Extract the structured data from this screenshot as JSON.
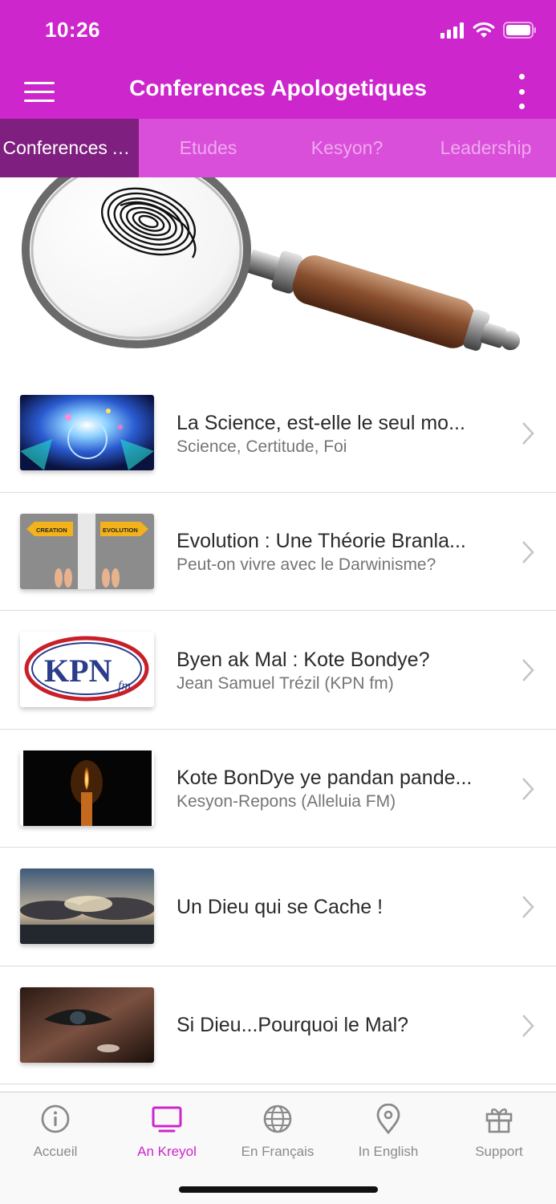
{
  "status_bar": {
    "time": "10:26"
  },
  "app_bar": {
    "title": "Conferences Apologetiques"
  },
  "tabs": [
    {
      "label": "Conferences Apologetiques",
      "active": true
    },
    {
      "label": "Etudes",
      "active": false
    },
    {
      "label": "Kesyon?",
      "active": false
    },
    {
      "label": "Leadership",
      "active": false
    }
  ],
  "items": [
    {
      "title": "La Science, est-elle le seul mo...",
      "subtitle": "Science, Certitude, Foi",
      "thumb": "science-brain-thumbnail"
    },
    {
      "title": "Evolution : Une Théorie Branla...",
      "subtitle": "Peut-on vivre avec le Darwinisme?",
      "thumb": "creation-evolution-thumbnail",
      "thumb_labels": [
        "CREATION",
        "EVOLUTION"
      ]
    },
    {
      "title": "Byen ak Mal : Kote Bondye?",
      "subtitle": "Jean Samuel Trézil (KPN fm)",
      "thumb": "kpn-fm-logo-thumbnail",
      "thumb_labels": [
        "KPN",
        "fm"
      ]
    },
    {
      "title": "Kote BonDye ye pandan pande...",
      "subtitle": "Kesyon-Repons (Alleluia FM)",
      "thumb": "candle-thumbnail"
    },
    {
      "title": "Un Dieu qui se Cache !",
      "subtitle": "",
      "thumb": "clouds-sunset-thumbnail"
    },
    {
      "title": "Si Dieu...Pourquoi le Mal?",
      "subtitle": "",
      "thumb": "tear-eye-thumbnail"
    }
  ],
  "bottom_tabs": [
    {
      "label": "Accueil",
      "icon": "info-icon",
      "active": false
    },
    {
      "label": "An Kreyol",
      "icon": "tv-icon",
      "active": true
    },
    {
      "label": "En Français",
      "icon": "globe-icon",
      "active": false
    },
    {
      "label": "In English",
      "icon": "location-pin-icon",
      "active": false
    },
    {
      "label": "Support",
      "icon": "gift-icon",
      "active": false
    }
  ],
  "colors": {
    "primary": "#cc26cc",
    "tab_strip": "#d94fd9",
    "tab_active": "#7f1f7f",
    "inactive_label": "#8a8a8a"
  }
}
